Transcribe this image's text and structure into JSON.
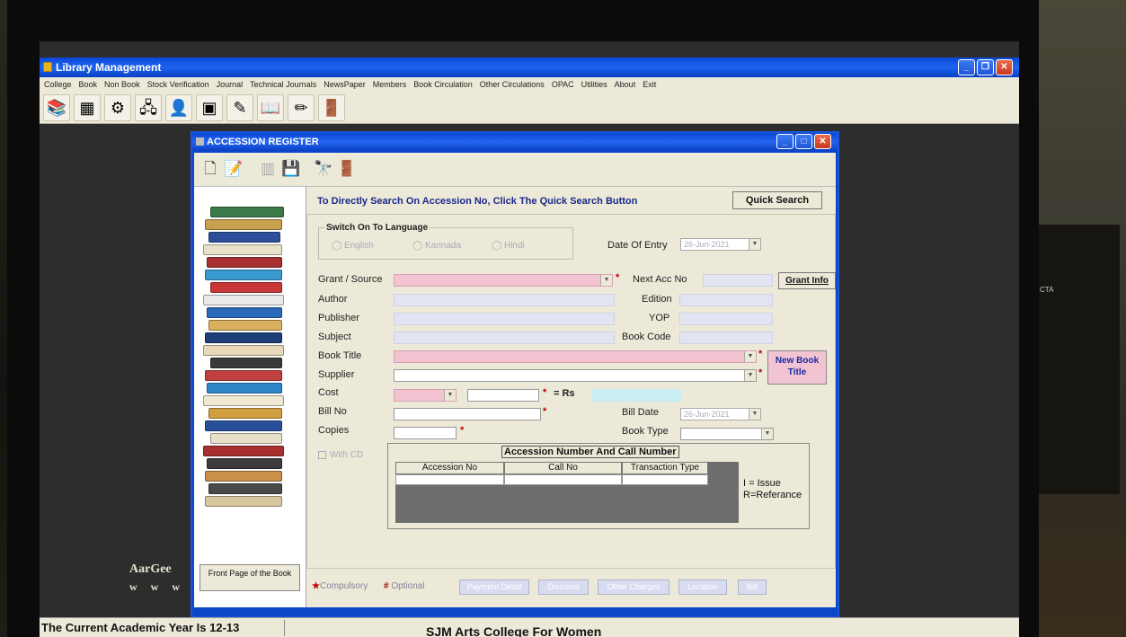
{
  "main_window": {
    "title": "Library Management",
    "menu": [
      "College",
      "Book",
      "Non Book",
      "Stock Verification",
      "Journal",
      "Technical Journals",
      "NewsPaper",
      "Members",
      "Book Circulation",
      "Other Circulations",
      "OPAC",
      "Utilities",
      "About",
      "Exit"
    ],
    "toolbar_icons": [
      "books-icon",
      "grid-icon",
      "gear-icon",
      "network-icon",
      "person-icon",
      "screen-icon",
      "tools-icon",
      "book-icon",
      "pencil-icon",
      "exit-door-icon"
    ],
    "status_left": "The Current Academic Year Is 12-13",
    "status_center": "SJM Arts College For Women",
    "backdrop_brand": "AarGee",
    "backdrop_url": "w w w"
  },
  "window": {
    "title": "ACCESSION REGISTER",
    "quick_search_hint": "To Directly Search On Accession No, Click The Quick Search Button",
    "quick_search_button": "Quick Search",
    "front_page_button": "Front Page of the Book"
  },
  "language": {
    "group_title": "Switch On To Language",
    "options": [
      "English",
      "Kannada",
      "Hindi"
    ]
  },
  "form": {
    "date_of_entry_label": "Date Of Entry",
    "date_of_entry_value": "26-Jun-2021",
    "grant_source_label": "Grant / Source",
    "next_acc_no_label": "Next Acc No",
    "grant_info_button": "Grant Info",
    "author_label": "Author",
    "edition_label": "Edition",
    "publisher_label": "Publisher",
    "yop_label": "YOP",
    "subject_label": "Subject",
    "book_code_label": "Book Code",
    "book_title_label": "Book Title",
    "new_book_title_button": "New Book Title",
    "supplier_label": "Supplier",
    "cost_label": "Cost",
    "equals_rs": "= Rs",
    "bill_no_label": "Bill No",
    "bill_date_label": "Bill Date",
    "bill_date_value": "26-Jun-2021",
    "copies_label": "Copies",
    "book_type_label": "Book Type",
    "with_cd_label": "With CD"
  },
  "grid": {
    "title": "Accession Number And Call Number",
    "columns": [
      "Accession No",
      "Call No",
      "Transaction Type"
    ],
    "legend": [
      "I = Issue",
      "R=Referance"
    ]
  },
  "footer": {
    "compulsory": "Compulsory",
    "optional": "Optional",
    "buttons": [
      "Payment Detail",
      "Discount",
      "Other Charges",
      "Location",
      "Bill"
    ]
  },
  "photo": {
    "right_tag": "CTA"
  }
}
